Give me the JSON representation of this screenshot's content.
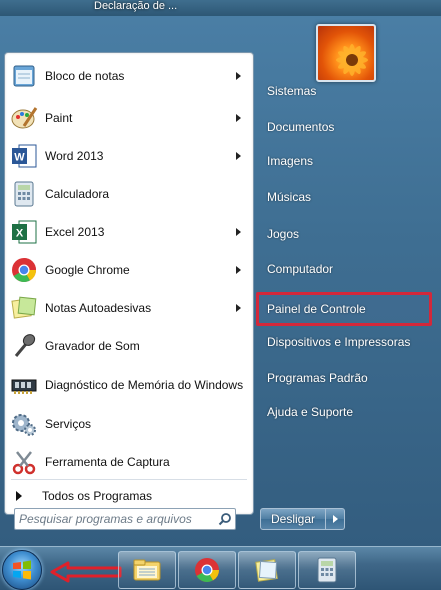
{
  "window": {
    "title": "Declaração de ..."
  },
  "start_menu": {
    "programs": [
      {
        "label": "Bloco de notas",
        "icon": "notepad-icon",
        "has_submenu": true
      },
      {
        "label": "Paint",
        "icon": "paint-icon",
        "has_submenu": true
      },
      {
        "label": "Word 2013",
        "icon": "word-icon",
        "has_submenu": true
      },
      {
        "label": "Calculadora",
        "icon": "calculator-icon",
        "has_submenu": false
      },
      {
        "label": "Excel 2013",
        "icon": "excel-icon",
        "has_submenu": true
      },
      {
        "label": "Google Chrome",
        "icon": "chrome-icon",
        "has_submenu": true
      },
      {
        "label": "Notas Autoadesivas",
        "icon": "sticky-notes-icon",
        "has_submenu": true
      },
      {
        "label": "Gravador de Som",
        "icon": "microphone-icon",
        "has_submenu": false
      },
      {
        "label": "Diagnóstico de Memória do Windows",
        "icon": "memory-diagnostic-icon",
        "has_submenu": false
      },
      {
        "label": "Serviços",
        "icon": "services-gear-icon",
        "has_submenu": false
      },
      {
        "label": "Ferramenta de Captura",
        "icon": "scissors-icon",
        "has_submenu": false
      }
    ],
    "all_programs": "Todos os Programas",
    "search": {
      "placeholder": "Pesquisar programas e arquivos"
    },
    "right_items": [
      "Sistemas",
      "Documentos",
      "Imagens",
      "Músicas",
      "Jogos",
      "Computador",
      "Painel de Controle",
      "Dispositivos e Impressoras",
      "Programas Padrão",
      "Ajuda e Suporte"
    ],
    "highlighted_item": "Painel de Controle",
    "shutdown_label": "Desligar"
  },
  "colors": {
    "highlight_border": "#d3283a",
    "annotation_arrow": "#e0202a"
  },
  "taskbar": {
    "pinned": [
      "windows-explorer-icon",
      "chrome-icon",
      "sticky-notes-icon",
      "calculator-icon"
    ]
  }
}
